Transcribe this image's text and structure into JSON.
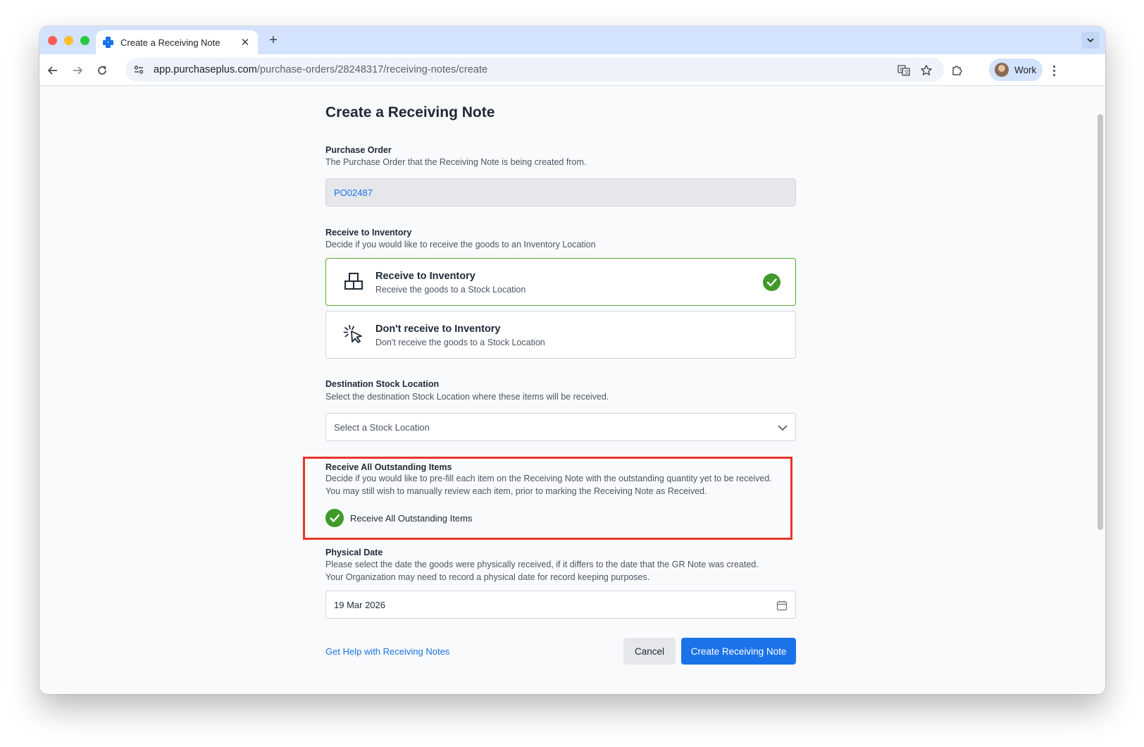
{
  "browser": {
    "tab_title": "Create a Receiving Note",
    "url_host": "app.purchaseplus.com",
    "url_path": "/purchase-orders/28248317/receiving-notes/create",
    "profile_label": "Work"
  },
  "page": {
    "title": "Create a Receiving Note",
    "purchase_order": {
      "label": "Purchase Order",
      "description": "The Purchase Order that the Receiving Note is being created from.",
      "value": "PO02487"
    },
    "receive_to_inventory": {
      "label": "Receive to Inventory",
      "description": "Decide if you would like to receive the goods to an Inventory Location",
      "options": [
        {
          "title": "Receive to Inventory",
          "subtitle": "Receive the goods to a Stock Location",
          "selected": true,
          "icon": "boxes-icon"
        },
        {
          "title": "Don't receive to Inventory",
          "subtitle": "Don't receive the goods to a Stock Location",
          "selected": false,
          "icon": "cursor-click-icon"
        }
      ]
    },
    "destination": {
      "label": "Destination Stock Location",
      "description": "Select the destination Stock Location where these items will be received.",
      "placeholder": "Select a Stock Location"
    },
    "receive_all": {
      "label": "Receive All Outstanding Items",
      "description_line1": "Decide if you would like to pre-fill each item on the Receiving Note with the outstanding quantity yet to be received.",
      "description_line2": "You may still wish to manually review each item, prior to marking the Receiving Note as Received.",
      "checkbox_label": "Receive All Outstanding Items",
      "checked": true
    },
    "physical_date": {
      "label": "Physical Date",
      "description_line1": "Please select the date the goods were physically received, if it differs to the date that the GR Note was created.",
      "description_line2": "Your Organization may need to record a physical date for record keeping purposes.",
      "value": "19 Mar 2026"
    },
    "footer": {
      "help_link": "Get Help with Receiving Notes",
      "cancel_label": "Cancel",
      "create_label": "Create Receiving Note"
    }
  },
  "colors": {
    "accent": "#1a73e8",
    "success": "#3f9a2a",
    "highlight": "#e8352a"
  }
}
